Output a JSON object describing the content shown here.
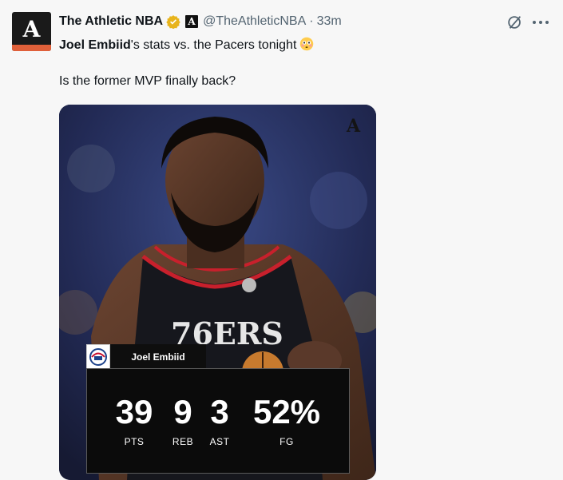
{
  "account": {
    "name": "The Athletic NBA",
    "handle": "@TheAthleticNBA",
    "separator": "·",
    "time": "33m",
    "avatar_letter": "A",
    "affiliate_letter": "A"
  },
  "tweet": {
    "line1_bold": "Joel Embiid",
    "line1_rest": "'s stats vs. the Pacers tonight",
    "line2": "Is the former MVP finally back?"
  },
  "media": {
    "watermark": "A",
    "player_name": "Joel Embiid",
    "stats": [
      {
        "value": "39",
        "label": "PTS"
      },
      {
        "value": "9",
        "label": "REB"
      },
      {
        "value": "3",
        "label": "AST"
      },
      {
        "value": "52%",
        "label": "FG"
      }
    ]
  },
  "colors": {
    "verified": "#e8b41c",
    "avatar_bar": "#e0603a",
    "secondary_text": "#536471"
  },
  "icons": [
    "verified-badge-icon",
    "affiliate-icon",
    "grok-icon",
    "more-options-icon",
    "flushed-face-emoji"
  ]
}
